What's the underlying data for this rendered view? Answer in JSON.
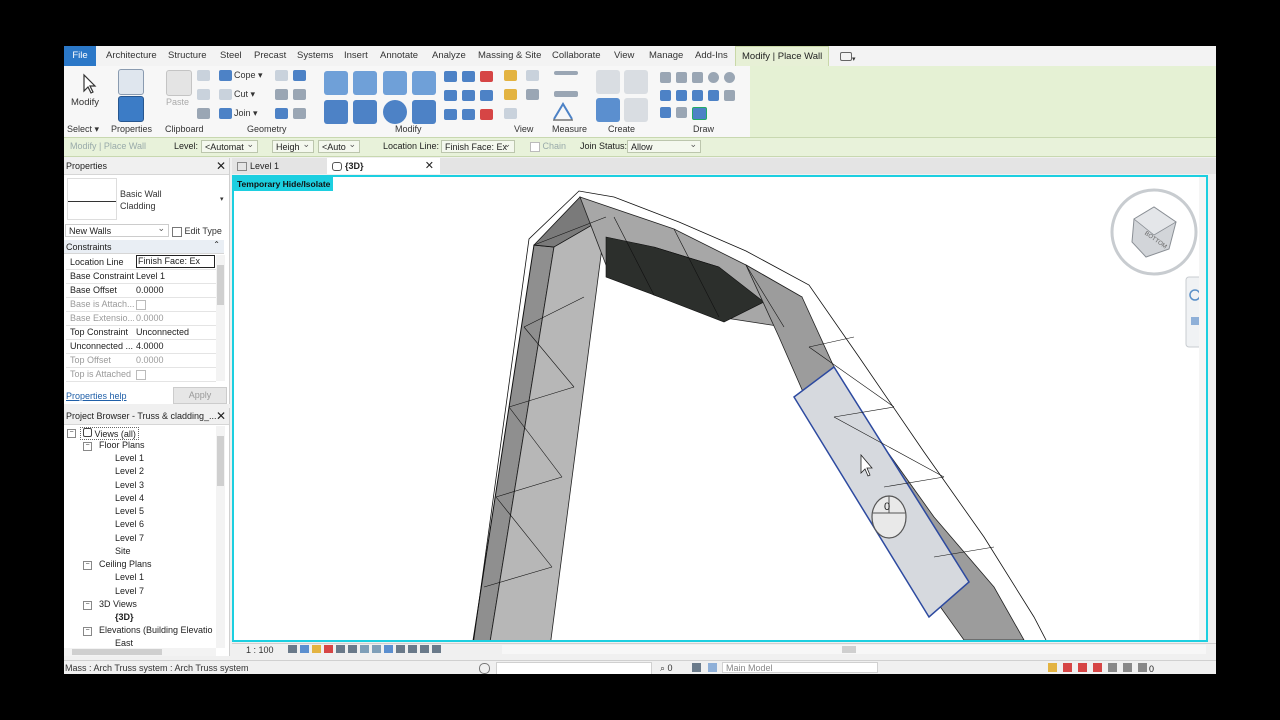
{
  "ribbon": {
    "tabs": [
      "File",
      "Architecture",
      "Structure",
      "Steel",
      "Precast",
      "Systems",
      "Insert",
      "Annotate",
      "Analyze",
      "Massing & Site",
      "Collaborate",
      "View",
      "Manage",
      "Add-Ins",
      "Modify | Place Wall"
    ],
    "panels": [
      "Select",
      "Properties",
      "Clipboard",
      "Geometry",
      "Modify",
      "View",
      "Measure",
      "Create",
      "Draw"
    ],
    "modify_label": "Modify",
    "paste_label": "Paste",
    "properties_label": "Properties",
    "cope_label": "Cope",
    "cut_label": "Cut",
    "join_label": "Join"
  },
  "options_bar": {
    "context": "Modify | Place Wall",
    "level_label": "Level:",
    "level_value": "<Automat",
    "height_value": "Heigh",
    "auto_value": "<Auto",
    "location_line_label": "Location Line:",
    "location_line_value": "Finish Face: Ex",
    "chain_label": "Chain",
    "join_status_label": "Join Status:",
    "join_status_value": "Allow"
  },
  "properties": {
    "title": "Properties",
    "family": "Basic Wall",
    "type": "Cladding",
    "instance_filter": "New Walls",
    "edit_type": "Edit Type",
    "section": "Constraints",
    "rows": [
      {
        "k": "Location Line",
        "v": "Finish Face: Ex"
      },
      {
        "k": "Base Constraint",
        "v": "Level 1"
      },
      {
        "k": "Base Offset",
        "v": "0.0000"
      },
      {
        "k": "Base is Attach...",
        "v": ""
      },
      {
        "k": "Base Extensio...",
        "v": "0.0000"
      },
      {
        "k": "Top Constraint",
        "v": "Unconnected"
      },
      {
        "k": "Unconnected ...",
        "v": "4.0000"
      },
      {
        "k": "Top Offset",
        "v": "0.0000"
      },
      {
        "k": "Top is Attached",
        "v": ""
      }
    ],
    "help_link": "Properties help",
    "apply": "Apply"
  },
  "browser": {
    "title": "Project Browser - Truss & cladding_...",
    "root": "Views (all)",
    "floor_plans": "Floor Plans",
    "floor_items": [
      "Level 1",
      "Level 2",
      "Level 3",
      "Level 4",
      "Level 5",
      "Level 6",
      "Level 7",
      "Site"
    ],
    "ceiling_plans": "Ceiling Plans",
    "ceiling_items": [
      "Level 1",
      "Level 7"
    ],
    "views_3d": "3D Views",
    "views_3d_items": [
      "{3D}"
    ],
    "elevations": "Elevations (Building Elevatio",
    "elev_items": [
      "East"
    ]
  },
  "doc_tabs": [
    "Level 1",
    "{3D}"
  ],
  "viewport": {
    "banner": "Temporary Hide/Isolate",
    "viewcube_face": "BOTTOM",
    "scale": "1 : 100",
    "mouse_hint": "0"
  },
  "status": {
    "text": "Mass : Arch Truss system : Arch Truss system",
    "zero_a": "0",
    "model": "Main Model",
    "zero_b": "0"
  }
}
